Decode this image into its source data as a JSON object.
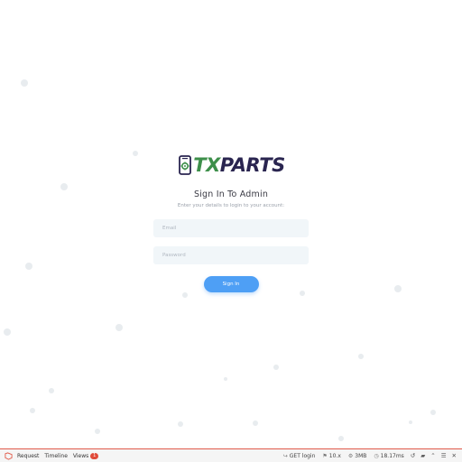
{
  "brand": {
    "prefix": "TX",
    "suffix": "PARTS",
    "prefix_color": "#3d8f4a",
    "suffix_color": "#2a2550"
  },
  "login": {
    "title": "Sign In To Admin",
    "subtitle": "Enter your details to login to your account:",
    "email_placeholder": "Email",
    "password_placeholder": "Password",
    "submit_label": "Sign In"
  },
  "debugbar": {
    "tabs": {
      "request": "Request",
      "timeline": "Timeline",
      "views": "Views"
    },
    "views_count": "1",
    "route": "GET login",
    "version": "10.x",
    "memory": "3MB",
    "duration": "18.17ms",
    "accent_color": "#e05a4a"
  }
}
